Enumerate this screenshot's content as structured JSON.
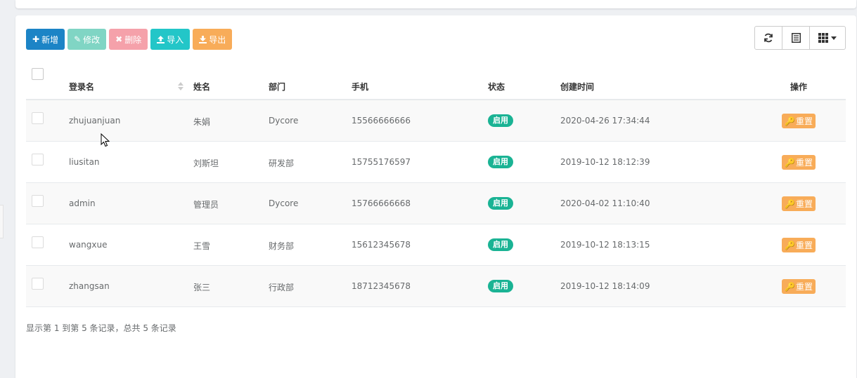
{
  "toolbar": {
    "add_label": "新增",
    "edit_label": "修改",
    "delete_label": "删除",
    "import_label": "导入",
    "export_label": "导出"
  },
  "table": {
    "headers": {
      "login": "登录名",
      "name": "姓名",
      "dept": "部门",
      "phone": "手机",
      "status": "状态",
      "created": "创建时间",
      "actions": "操作"
    },
    "rows": [
      {
        "login": "zhujuanjuan",
        "name": "朱娟",
        "dept": "Dycore",
        "phone": "15566666666",
        "status": "启用",
        "created": "2020-04-26 17:34:44",
        "action": "重置"
      },
      {
        "login": "liusitan",
        "name": "刘斯坦",
        "dept": "研发部",
        "phone": "15755176597",
        "status": "启用",
        "created": "2019-10-12 18:12:39",
        "action": "重置"
      },
      {
        "login": "admin",
        "name": "管理员",
        "dept": "Dycore",
        "phone": "15766666668",
        "status": "启用",
        "created": "2020-04-02 11:10:40",
        "action": "重置"
      },
      {
        "login": "wangxue",
        "name": "王雪",
        "dept": "财务部",
        "phone": "15612345678",
        "status": "启用",
        "created": "2019-10-12 18:13:15",
        "action": "重置"
      },
      {
        "login": "zhangsan",
        "name": "张三",
        "dept": "行政部",
        "phone": "18712345678",
        "status": "启用",
        "created": "2019-10-12 18:14:09",
        "action": "重置"
      }
    ]
  },
  "pagination": {
    "summary": "显示第 1 到第 5 条记录，总共 5 条记录"
  },
  "colors": {
    "primary": "#1c84c6",
    "success": "#1ab394",
    "danger": "#ed5565",
    "info": "#23c6c8",
    "warning": "#f8ac59"
  }
}
